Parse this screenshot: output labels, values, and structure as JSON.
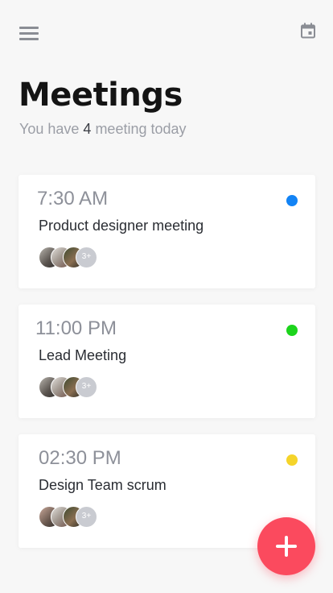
{
  "header": {
    "menu_icon": "hamburger-menu-icon",
    "calendar_icon": "calendar-icon",
    "icon_color": "#8a8d94"
  },
  "page": {
    "title": "Meetings",
    "subtitle_prefix": "You have ",
    "meeting_count": "4",
    "subtitle_suffix": " meeting today"
  },
  "meetings": [
    {
      "time": "7:30 AM",
      "title": "Product designer meeting",
      "status_color": "#1283f5",
      "extra_attendees": "3+"
    },
    {
      "time": "11:00 PM",
      "title": "Lead Meeting",
      "status_color": "#1cd41c",
      "extra_attendees": "3+"
    },
    {
      "time": "02:30 PM",
      "title": "Design Team scrum",
      "status_color": "#f5d42a",
      "extra_attendees": "3+"
    }
  ],
  "fab": {
    "icon": "plus-icon",
    "color": "#fb4a5e"
  }
}
